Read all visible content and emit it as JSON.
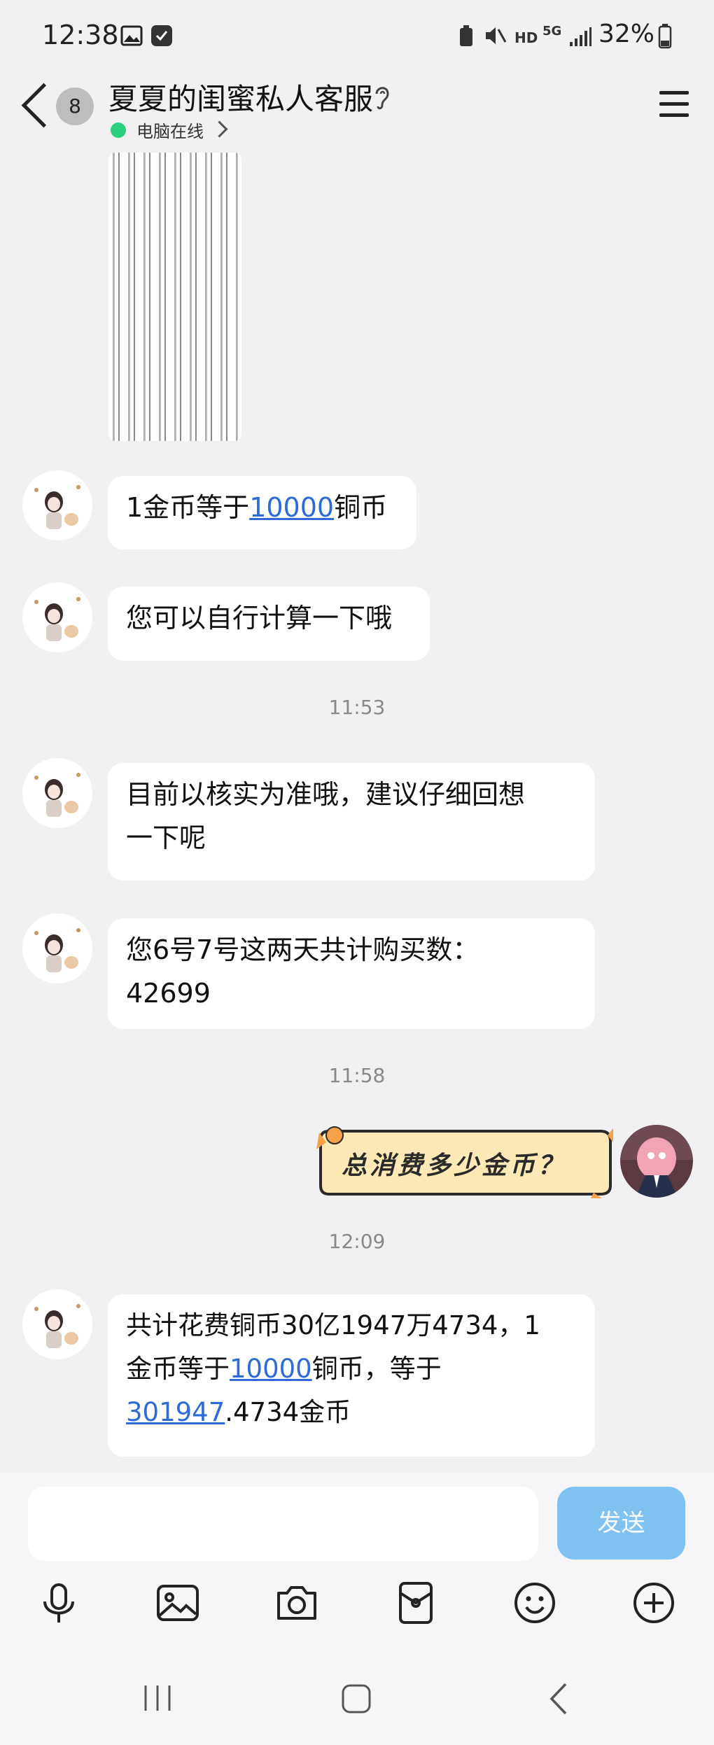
{
  "status_bar": {
    "time": "12:38",
    "hd_label": "HD",
    "net_label": "5G",
    "battery": "32%"
  },
  "header": {
    "badge_count": "8",
    "title": "夏夏的闺蜜私人客服",
    "online_status": "电脑在线"
  },
  "messages": {
    "m1": {
      "pre": "1金币等于",
      "link": "10000",
      "post": "铜币"
    },
    "m2": {
      "text": "您可以自行计算一下哦"
    },
    "t1": "11:53",
    "m3": {
      "line1": "目前以核实为准哦，建议仔细回想",
      "line2": "一下呢"
    },
    "m4": {
      "line1": "您6号7号这两天共计购买数：",
      "line2": "42699"
    },
    "t2": "11:58",
    "sticker_text": "总消费多少金币？",
    "t3": "12:09",
    "m5": {
      "line1": "共计花费铜币30亿1947万4734，1",
      "line2_pre": "金币等于",
      "line2_link": "10000",
      "line2_post": "铜币，等于",
      "line3_link": "301947",
      "line3_post": ".4734金币"
    }
  },
  "input": {
    "placeholder": "",
    "send_label": "发送"
  },
  "toolbar": [
    "mic-icon",
    "image-icon",
    "camera-icon",
    "red-packet-icon",
    "emoji-icon",
    "plus-icon"
  ],
  "colors": {
    "link": "#2f6bd4",
    "send": "#7fc2f2",
    "online": "#2bd17e"
  }
}
